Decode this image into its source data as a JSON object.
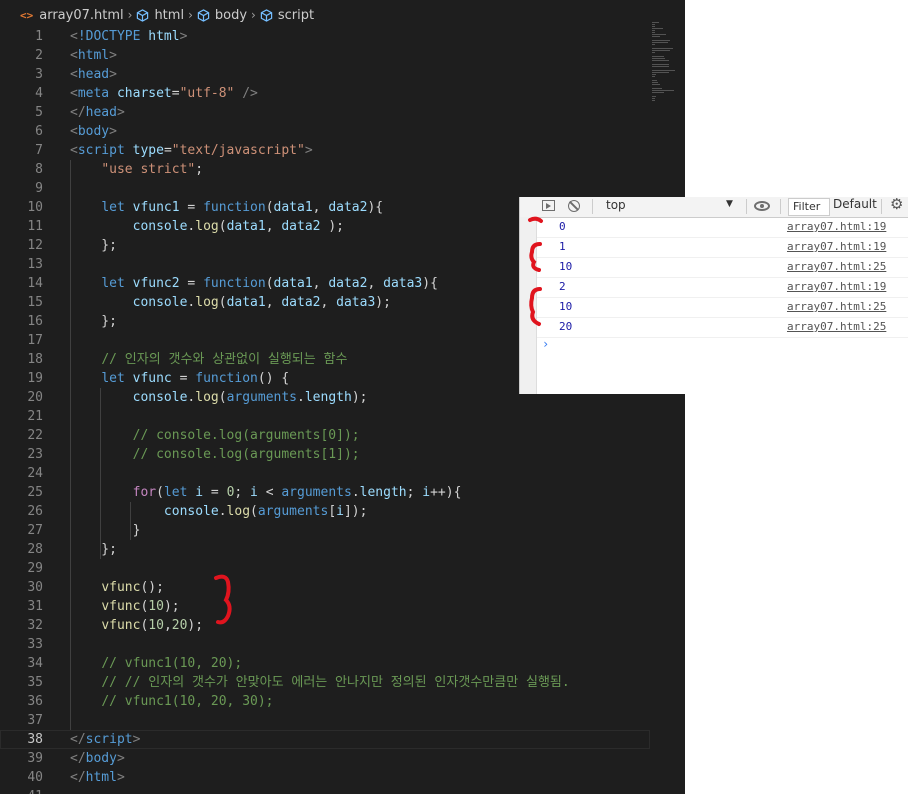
{
  "breadcrumb": {
    "items": [
      "array07.html",
      "html",
      "body",
      "script"
    ],
    "file_icon": "<>"
  },
  "editor": {
    "lines": [
      {
        "n": "1",
        "tokens": [
          [
            "t",
            "<"
          ],
          [
            "k",
            "!DOCTYPE"
          ],
          [
            "p",
            " "
          ],
          [
            "a",
            "html"
          ],
          [
            "t",
            ">"
          ]
        ]
      },
      {
        "n": "2",
        "tokens": [
          [
            "t",
            "<"
          ],
          [
            "k",
            "html"
          ],
          [
            "t",
            ">"
          ]
        ]
      },
      {
        "n": "3",
        "tokens": [
          [
            "t",
            "<"
          ],
          [
            "k",
            "head"
          ],
          [
            "t",
            ">"
          ]
        ]
      },
      {
        "n": "4",
        "tokens": [
          [
            "t",
            "<"
          ],
          [
            "k",
            "meta"
          ],
          [
            "p",
            " "
          ],
          [
            "a",
            "charset"
          ],
          [
            "p",
            "="
          ],
          [
            "s",
            "\"utf-8\""
          ],
          [
            "p",
            " "
          ],
          [
            "t",
            "/>"
          ]
        ]
      },
      {
        "n": "5",
        "tokens": [
          [
            "t",
            "</"
          ],
          [
            "k",
            "head"
          ],
          [
            "t",
            ">"
          ]
        ]
      },
      {
        "n": "6",
        "tokens": [
          [
            "t",
            "<"
          ],
          [
            "k",
            "body"
          ],
          [
            "t",
            ">"
          ]
        ]
      },
      {
        "n": "7",
        "tokens": [
          [
            "t",
            "<"
          ],
          [
            "k",
            "script"
          ],
          [
            "p",
            " "
          ],
          [
            "a",
            "type"
          ],
          [
            "p",
            "="
          ],
          [
            "s",
            "\"text/javascript\""
          ],
          [
            "t",
            ">"
          ]
        ]
      },
      {
        "n": "8",
        "tokens": [
          [
            "p",
            "    "
          ],
          [
            "s",
            "\"use strict\""
          ],
          [
            "p",
            ";"
          ]
        ]
      },
      {
        "n": "9",
        "tokens": []
      },
      {
        "n": "10",
        "tokens": [
          [
            "p",
            "    "
          ],
          [
            "k",
            "let"
          ],
          [
            "p",
            " "
          ],
          [
            "a",
            "vfunc1"
          ],
          [
            "p",
            " = "
          ],
          [
            "k",
            "function"
          ],
          [
            "p",
            "("
          ],
          [
            "a",
            "data1"
          ],
          [
            "p",
            ", "
          ],
          [
            "a",
            "data2"
          ],
          [
            "p",
            "){"
          ]
        ]
      },
      {
        "n": "11",
        "tokens": [
          [
            "p",
            "        "
          ],
          [
            "a",
            "console"
          ],
          [
            "p",
            "."
          ],
          [
            "f",
            "log"
          ],
          [
            "p",
            "("
          ],
          [
            "a",
            "data1"
          ],
          [
            "p",
            ", "
          ],
          [
            "a",
            "data2"
          ],
          [
            "p",
            " );"
          ]
        ]
      },
      {
        "n": "12",
        "tokens": [
          [
            "p",
            "    };"
          ]
        ]
      },
      {
        "n": "13",
        "tokens": []
      },
      {
        "n": "14",
        "tokens": [
          [
            "p",
            "    "
          ],
          [
            "k",
            "let"
          ],
          [
            "p",
            " "
          ],
          [
            "a",
            "vfunc2"
          ],
          [
            "p",
            " = "
          ],
          [
            "k",
            "function"
          ],
          [
            "p",
            "("
          ],
          [
            "a",
            "data1"
          ],
          [
            "p",
            ", "
          ],
          [
            "a",
            "data2"
          ],
          [
            "p",
            ", "
          ],
          [
            "a",
            "data3"
          ],
          [
            "p",
            "){"
          ]
        ]
      },
      {
        "n": "15",
        "tokens": [
          [
            "p",
            "        "
          ],
          [
            "a",
            "console"
          ],
          [
            "p",
            "."
          ],
          [
            "f",
            "log"
          ],
          [
            "p",
            "("
          ],
          [
            "a",
            "data1"
          ],
          [
            "p",
            ", "
          ],
          [
            "a",
            "data2"
          ],
          [
            "p",
            ", "
          ],
          [
            "a",
            "data3"
          ],
          [
            "p",
            ");"
          ]
        ]
      },
      {
        "n": "16",
        "tokens": [
          [
            "p",
            "    };"
          ]
        ]
      },
      {
        "n": "17",
        "tokens": []
      },
      {
        "n": "18",
        "tokens": [
          [
            "p",
            "    "
          ],
          [
            "c",
            "// 인자의 갯수와 상관없이 실행되는 함수"
          ]
        ]
      },
      {
        "n": "19",
        "tokens": [
          [
            "p",
            "    "
          ],
          [
            "k",
            "let"
          ],
          [
            "p",
            " "
          ],
          [
            "a",
            "vfunc"
          ],
          [
            "p",
            " = "
          ],
          [
            "k",
            "function"
          ],
          [
            "p",
            "() {"
          ]
        ]
      },
      {
        "n": "20",
        "tokens": [
          [
            "p",
            "        "
          ],
          [
            "a",
            "console"
          ],
          [
            "p",
            "."
          ],
          [
            "f",
            "log"
          ],
          [
            "p",
            "("
          ],
          [
            "k",
            "arguments"
          ],
          [
            "p",
            "."
          ],
          [
            "a",
            "length"
          ],
          [
            "p",
            ");"
          ]
        ]
      },
      {
        "n": "21",
        "tokens": []
      },
      {
        "n": "22",
        "tokens": [
          [
            "p",
            "        "
          ],
          [
            "c",
            "// console.log(arguments[0]);"
          ]
        ]
      },
      {
        "n": "23",
        "tokens": [
          [
            "p",
            "        "
          ],
          [
            "c",
            "// console.log(arguments[1]);"
          ]
        ]
      },
      {
        "n": "24",
        "tokens": []
      },
      {
        "n": "25",
        "tokens": [
          [
            "p",
            "        "
          ],
          [
            "ctl",
            "for"
          ],
          [
            "p",
            "("
          ],
          [
            "k",
            "let"
          ],
          [
            "p",
            " "
          ],
          [
            "a",
            "i"
          ],
          [
            "p",
            " = "
          ],
          [
            "n",
            "0"
          ],
          [
            "p",
            "; "
          ],
          [
            "a",
            "i"
          ],
          [
            "p",
            " < "
          ],
          [
            "k",
            "arguments"
          ],
          [
            "p",
            "."
          ],
          [
            "a",
            "length"
          ],
          [
            "p",
            "; "
          ],
          [
            "a",
            "i"
          ],
          [
            "p",
            "++){"
          ]
        ]
      },
      {
        "n": "26",
        "tokens": [
          [
            "p",
            "            "
          ],
          [
            "a",
            "console"
          ],
          [
            "p",
            "."
          ],
          [
            "f",
            "log"
          ],
          [
            "p",
            "("
          ],
          [
            "k",
            "arguments"
          ],
          [
            "p",
            "["
          ],
          [
            "a",
            "i"
          ],
          [
            "p",
            "]);"
          ]
        ]
      },
      {
        "n": "27",
        "tokens": [
          [
            "p",
            "        }"
          ]
        ]
      },
      {
        "n": "28",
        "tokens": [
          [
            "p",
            "    };"
          ]
        ]
      },
      {
        "n": "29",
        "tokens": []
      },
      {
        "n": "30",
        "tokens": [
          [
            "p",
            "    "
          ],
          [
            "f",
            "vfunc"
          ],
          [
            "p",
            "();"
          ]
        ]
      },
      {
        "n": "31",
        "tokens": [
          [
            "p",
            "    "
          ],
          [
            "f",
            "vfunc"
          ],
          [
            "p",
            "("
          ],
          [
            "n",
            "10"
          ],
          [
            "p",
            ");"
          ]
        ]
      },
      {
        "n": "32",
        "tokens": [
          [
            "p",
            "    "
          ],
          [
            "f",
            "vfunc"
          ],
          [
            "p",
            "("
          ],
          [
            "n",
            "10"
          ],
          [
            "p",
            ","
          ],
          [
            "n",
            "20"
          ],
          [
            "p",
            ");"
          ]
        ]
      },
      {
        "n": "33",
        "tokens": []
      },
      {
        "n": "34",
        "tokens": [
          [
            "p",
            "    "
          ],
          [
            "c",
            "// vfunc1(10, 20);"
          ]
        ]
      },
      {
        "n": "35",
        "tokens": [
          [
            "p",
            "    "
          ],
          [
            "c",
            "// // 인자의 갯수가 안맞아도 에러는 안나지만 정의된 인자갯수만큼만 실행됨."
          ]
        ]
      },
      {
        "n": "36",
        "tokens": [
          [
            "p",
            "    "
          ],
          [
            "c",
            "// vfunc1(10, 20, 30);"
          ]
        ]
      },
      {
        "n": "37",
        "tokens": []
      },
      {
        "n": "38",
        "tokens": [
          [
            "t",
            "</"
          ],
          [
            "k",
            "script"
          ],
          [
            "t",
            ">"
          ]
        ]
      },
      {
        "n": "39",
        "tokens": [
          [
            "t",
            "</"
          ],
          [
            "k",
            "body"
          ],
          [
            "t",
            ">"
          ]
        ]
      },
      {
        "n": "40",
        "tokens": [
          [
            "t",
            "</"
          ],
          [
            "k",
            "html"
          ],
          [
            "t",
            ">"
          ]
        ]
      },
      {
        "n": "41",
        "tokens": []
      }
    ],
    "colors": {
      "background": "#1e1e1e",
      "keyword": "#569cd6",
      "string": "#ce9178",
      "comment": "#6a9955",
      "function": "#dcdcaa",
      "variable": "#9cdcfe"
    }
  },
  "console": {
    "toolbar": {
      "context": "top",
      "filter_placeholder": "Filter",
      "levels": "Default"
    },
    "rows": [
      {
        "value": "0",
        "source": "array07.html:19"
      },
      {
        "value": "1",
        "source": "array07.html:19"
      },
      {
        "value": "10",
        "source": "array07.html:25"
      },
      {
        "value": "2",
        "source": "array07.html:19"
      },
      {
        "value": "10",
        "source": "array07.html:25"
      },
      {
        "value": "20",
        "source": "array07.html:25"
      }
    ],
    "prompt": "›",
    "colors": {
      "value": "#1a1aa6",
      "annotation": "#e0141e"
    }
  }
}
